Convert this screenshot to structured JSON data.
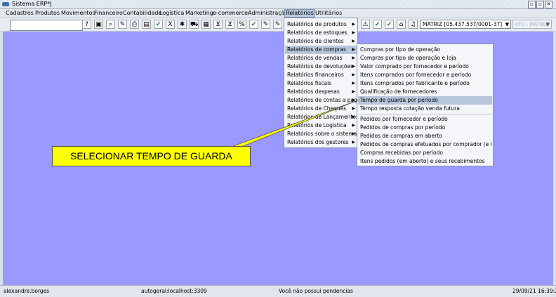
{
  "window": {
    "title": "Sistema ERP*J",
    "controls": [
      "▫",
      "▫",
      "✕"
    ]
  },
  "menubar": [
    "Cadastros",
    "Produtos",
    "Movimentos",
    "Financeiro",
    "Contabilidade",
    "Logística",
    "Marketing",
    "e-commerce",
    "Administração",
    "Relatórios",
    "Utilitários"
  ],
  "toolbar": {
    "search_value": "",
    "company_selected": "MATRIZ [05.437.537/0001-37]",
    "branch_selected": "UTU - MATRIZ"
  },
  "relatorios_menu": [
    "Relatórios de produtos",
    "Relatórios de estoques",
    "Relatórios de clientes",
    "Relatórios de compras",
    "Relatórios de vendas",
    "Relatórios de devoluções",
    "Relatórios financeiros",
    "Relatórios fiscais",
    "Relatórios despesas",
    "Relatórios de contas a pagar",
    "Relatórios de Cheques",
    "Relatórios de Lançamentos",
    "Relatórios de Logística",
    "Relatórios sobre o sistema",
    "Relatórios dos gestores"
  ],
  "compras_submenu": [
    "Compras por tipo de operação",
    "Compras por tipo de operação e loja",
    "Valor comprado por fornecedor e período",
    "Itens comprados por fornecedor e período",
    "Itens comprados por fabricante e período",
    "Qualificação de fornecedores",
    "Tempo de guarda por período",
    "Tempo resposta cotação venda futura",
    "Pedidos por fornecedor e período",
    "Pedidos de compras por período",
    "Pedidos de compras em aberto",
    "Pedidos de compras efetuados por comprador (e itens)",
    "Compras recebidas por período",
    "Itens pedidos (em aberto) e seus recebimentos"
  ],
  "callout": {
    "text": "SELECIONAR TEMPO DE GUARDA",
    "color": "#ffff00"
  },
  "statusbar": {
    "user": "alexandre.borges",
    "connection": "autogeral:localhost:3309",
    "message": "Você não possui pendencias",
    "datetime": "29/09/21 16:39:26"
  },
  "colors": {
    "desktop": "#9999ff",
    "highlight": "#b7c6da"
  }
}
